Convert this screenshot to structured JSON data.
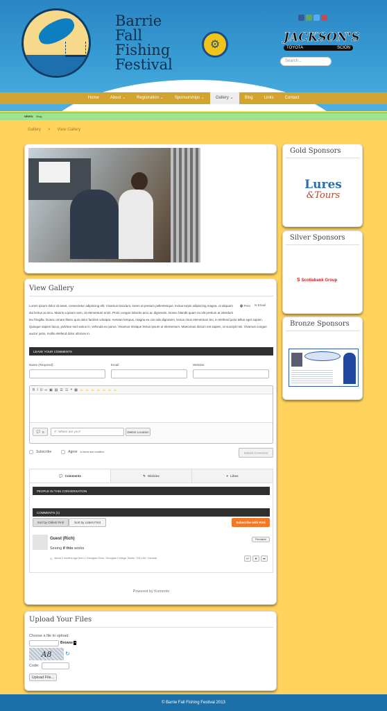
{
  "header": {
    "title_lines": [
      "Barrie",
      "Fall",
      "Fishing",
      "Festival"
    ],
    "search_placeholder": "Search...",
    "sponsor_logo": {
      "name": "JACKSON'S",
      "sub_left": "TOYOTA",
      "sub_right": "SCION"
    },
    "social_icons": [
      "facebook-icon",
      "plus-icon",
      "twitter-icon",
      "email-icon"
    ]
  },
  "nav": {
    "items": [
      {
        "label": "Home"
      },
      {
        "label": "About ⌄"
      },
      {
        "label": "Registration ⌄"
      },
      {
        "label": "Sponsorships ⌄"
      },
      {
        "label": "Gallery ⌄"
      },
      {
        "label": "Blog"
      },
      {
        "label": "Links"
      },
      {
        "label": "Contact"
      }
    ]
  },
  "news": {
    "label": "NEWS:",
    "value": "Blog"
  },
  "breadcrumb": {
    "items": [
      "Gallery",
      "View Gallery"
    ],
    "separator": ">"
  },
  "main": {
    "title": "View Gallery",
    "print_label": "Print",
    "email_label": "Email",
    "body_lines": [
      "Lorem ipsum dolor sit amet, consectetur adipiscing elit. Vivamus tincidunt, lorem at pretium pellentesque, lectus turpis adipiscing magna, ut aliquam",
      "dui lectus at arcu. Mauris a ipsum sem, at elementum enim. Proin congue lobortis arcu ac dignissim. Donec blandit quam eu elit pretium at interdum",
      "leo fringilla. Donec ornare libero quis dolor facilisis volutpat. Aenean tempus, magna eu con alis dignissim, lectus risus elementum leo, in eleifend justo tellus eget sapien.",
      "Quisque sapien lacus, pulvinar sed varius in, vehicula eu purus. Vivamus tristique lectus ipsum ut elementum. Maecenas dictum est sapien, ut suscipit nisi. Vivamus congue",
      "auctor justo, mollis eleifend dolor ultricies in."
    ]
  },
  "comment_form": {
    "header": "LEAVE YOUR COMMENTS",
    "name_label": "Name (Required):",
    "email_label": "Email:",
    "website_label": "Website:",
    "toolbar": [
      "B",
      "I",
      "U",
      "∞",
      "▣",
      "▤",
      "☰",
      "☷",
      "❝",
      "▦",
      "☺",
      "☺",
      "☺",
      "☺",
      "☺",
      "☺",
      "☺"
    ],
    "location_count": "0",
    "location_placeholder": "Where are you?",
    "detect_location": "Detect Location",
    "subscribe_label": "Subscribe",
    "agree_label": "Agree",
    "agree_suffix": "to terms and condition.",
    "submit_label": "Submit Comment"
  },
  "comments": {
    "tabs": [
      {
        "label": "Comments",
        "icon": "chat-icon"
      },
      {
        "label": "Stickies",
        "icon": "pin-icon"
      },
      {
        "label": "Likes",
        "icon": "heart-icon"
      }
    ],
    "people_header": "PEOPLE IN THIS CONVERSATION",
    "count_header": "COMMENTS (1)",
    "sort_oldest": "Sort by Oldest First",
    "sort_latest": "Sort by Latest First",
    "subscribe_rss": "Subscribe with RSS",
    "entry": {
      "author": "Guest (Rich)",
      "permalink": "Permalink",
      "text_pre": "Seeing ",
      "text_bold": "if this",
      "text_post": " works",
      "meta": "about 2 months ago from 1 Georgian Drive, Georgian College, Barrie, ON L4M, Canada"
    },
    "powered_by": "Powered by Komento"
  },
  "upload": {
    "title": "Upload Your Files",
    "choose_label": "Choose a file to upload:",
    "browse_label": "Browse",
    "captcha_text": "A8",
    "code_label": "Code:",
    "upload_button": "Upload File..."
  },
  "sidebar": {
    "gold": {
      "title": "Gold Sponsors",
      "logo_line1": "Lures",
      "logo_line2": "&Tours"
    },
    "silver": {
      "title": "Silver Sponsors",
      "logo_text": "Scotiabank Group"
    },
    "bronze": {
      "title": "Bronze Sponsors"
    }
  },
  "footer": {
    "text": "© Barrie Fall Fishing Festival 2013"
  },
  "colors": {
    "header_blue": "#2a86c4",
    "nav_gold": "#d1a432",
    "rss_orange": "#f07a2a",
    "footer_blue": "#1c70aa"
  }
}
